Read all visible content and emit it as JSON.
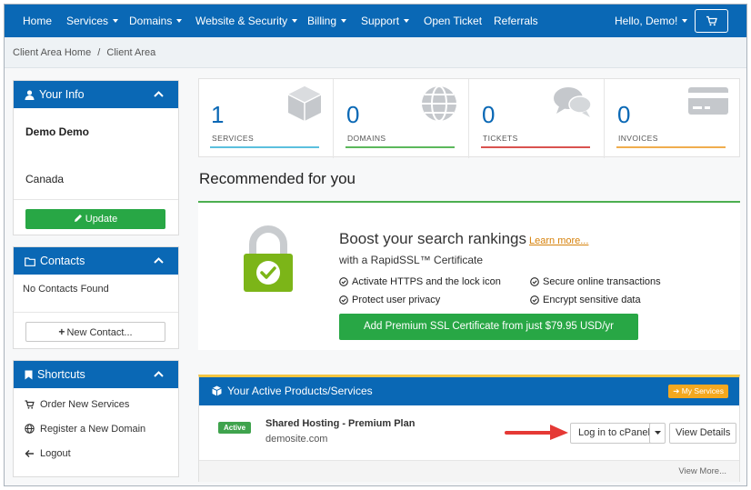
{
  "nav": {
    "home": "Home",
    "services": "Services",
    "domains": "Domains",
    "website_security": "Website & Security",
    "billing": "Billing",
    "support": "Support",
    "open_ticket": "Open Ticket",
    "referrals": "Referrals",
    "user_greeting": "Hello, Demo!",
    "cart_icon": "cart-icon"
  },
  "breadcrumb": {
    "home": "Client Area Home",
    "separator": "/",
    "current": "Client Area"
  },
  "your_info": {
    "title": "Your Info",
    "name": "Demo Demo",
    "country": "Canada",
    "update_button": "Update"
  },
  "contacts": {
    "title": "Contacts",
    "empty_text": "No Contacts Found",
    "new_contact_button": "New Contact..."
  },
  "shortcuts": {
    "title": "Shortcuts",
    "items": [
      {
        "label": "Order New Services",
        "icon": "cart-icon"
      },
      {
        "label": "Register a New Domain",
        "icon": "globe-icon"
      },
      {
        "label": "Logout",
        "icon": "arrow-left-icon"
      }
    ]
  },
  "stats": [
    {
      "value": "1",
      "label": "SERVICES",
      "color": "#5bc0de",
      "icon": "cube-icon"
    },
    {
      "value": "0",
      "label": "DOMAINS",
      "color": "#5cb85c",
      "icon": "globe-icon"
    },
    {
      "value": "0",
      "label": "TICKETS",
      "color": "#d9534f",
      "icon": "comments-icon"
    },
    {
      "value": "0",
      "label": "INVOICES",
      "color": "#f0ad4e",
      "icon": "credit-card-icon"
    }
  ],
  "recommended": {
    "title": "Recommended for you",
    "headline": "Boost your search rankings",
    "learn_more": "Learn more...",
    "subtitle": "with a RapidSSL™ Certificate",
    "features": [
      "Activate HTTPS and the lock icon",
      "Secure online transactions",
      "Protect user privacy",
      "Encrypt sensitive data"
    ],
    "cta_button": "Add Premium SSL Certificate from just $79.95 USD/yr"
  },
  "active_products": {
    "title": "Your Active Products/Services",
    "my_services_button": "My Services",
    "items": [
      {
        "status": "Active",
        "name": "Shared Hosting - Premium Plan",
        "domain": "demosite.com",
        "login_button": "Log in to cPanel",
        "details_button": "View Details"
      }
    ],
    "view_more": "View More..."
  },
  "colors": {
    "primary": "#0a68b5",
    "success": "#28a745",
    "accent_orange": "#f4a81f",
    "arrow_red": "#e53935"
  }
}
